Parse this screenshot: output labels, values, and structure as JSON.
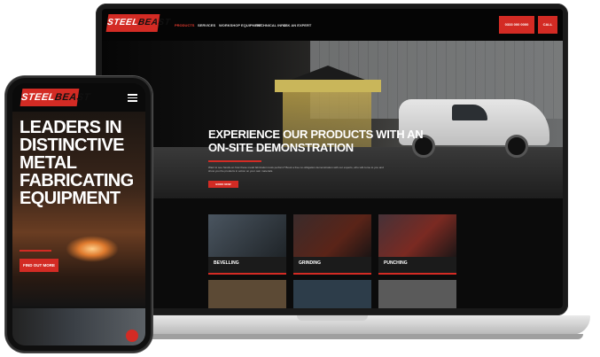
{
  "desktop": {
    "logo": {
      "part1": "STEEL",
      "part2": "BEAST"
    },
    "nav": [
      "PRODUCTS",
      "SERVICES",
      "WORKSHOP EQUIPMENT",
      "TECHNICAL INFO",
      "ASK AN EXPERT"
    ],
    "header_buttons": [
      "0333 000 0000",
      "CALL"
    ],
    "hero": {
      "title_line1": "EXPERIENCE OUR PRODUCTS WITH AN",
      "title_line2": "ON-SITE DEMONSTRATION",
      "body": "Want to see hands-on how these metal fabrication tools perform? Book a free no-obligation demonstration with our experts, who will come to you and show you the products in action on your own materials.",
      "button": "BOOK NOW"
    },
    "tiles": [
      {
        "label": "BEVELLING",
        "color": "#4a5560"
      },
      {
        "label": "GRINDING",
        "color": "#3a2b2b"
      },
      {
        "label": "PUNCHING",
        "color": "#463238"
      }
    ],
    "tiles_row2_colors": [
      "#5c4a35",
      "#2d3d4a",
      "#5a5a5a"
    ]
  },
  "mobile": {
    "logo": {
      "part1": "STEEL",
      "part2": "BEAST"
    },
    "menu_icon": "hamburger-icon",
    "title_lines": [
      "LEADERS IN",
      "DISTINCTIVE",
      "METAL",
      "FABRICATING",
      "EQUIPMENT"
    ],
    "button": "FIND OUT MORE",
    "chat_icon": "chat-icon"
  },
  "colors": {
    "brand_red": "#d32b24",
    "dark": "#0b0b0b"
  }
}
